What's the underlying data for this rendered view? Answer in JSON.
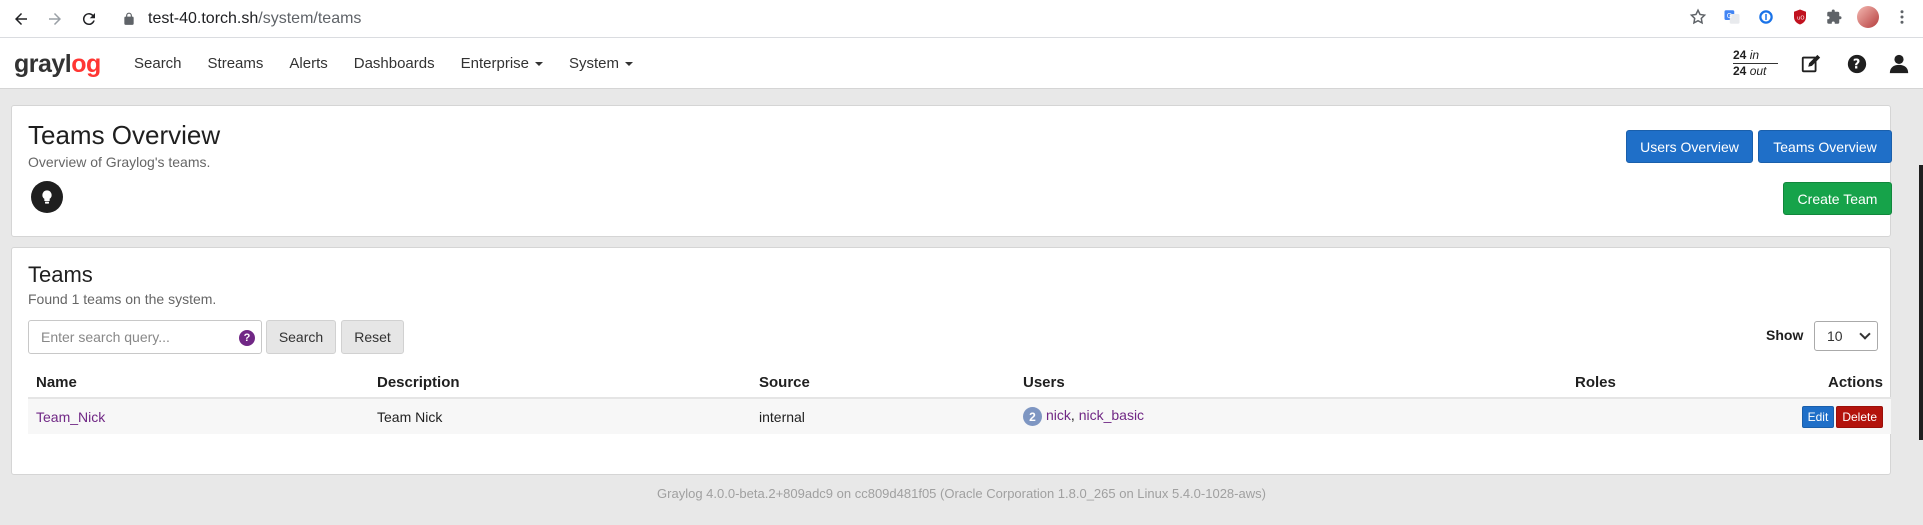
{
  "browser": {
    "url_host": "test-40.torch.sh",
    "url_path": "/system/teams"
  },
  "nav": {
    "logo_main": "grayl",
    "logo_accent": "o",
    "logo_end": "g",
    "items": [
      {
        "label": "Search"
      },
      {
        "label": "Streams"
      },
      {
        "label": "Alerts"
      },
      {
        "label": "Dashboards"
      },
      {
        "label": "Enterprise",
        "dropdown": true
      },
      {
        "label": "System",
        "dropdown": true
      }
    ],
    "throughput": {
      "in_value": "24",
      "in_label": "in",
      "out_value": "24",
      "out_label": "out"
    }
  },
  "header": {
    "title": "Teams Overview",
    "subtitle": "Overview of Graylog's teams.",
    "users_overview_label": "Users Overview",
    "teams_overview_label": "Teams Overview",
    "create_team_label": "Create Team"
  },
  "teams_section": {
    "title": "Teams",
    "subtitle": "Found 1 teams on the system.",
    "search_placeholder": "Enter search query...",
    "search_label": "Search",
    "reset_label": "Reset",
    "show_label": "Show",
    "page_size": "10",
    "columns": [
      "Name",
      "Description",
      "Source",
      "Users",
      "Roles",
      "Actions"
    ],
    "rows": [
      {
        "name": "Team_Nick",
        "description": "Team Nick",
        "source": "internal",
        "user_count": "2",
        "user_1": "nick",
        "separator": ", ",
        "user_2": "nick_basic",
        "roles": "",
        "edit_label": "Edit",
        "delete_label": "Delete"
      }
    ]
  },
  "footer": {
    "text": "Graylog 4.0.0-beta.2+809adc9 on cc809d481f05 (Oracle Corporation 1.8.0_265 on Linux 5.4.0-1028-aws)"
  },
  "colors": {
    "primary_blue": "#1f6fc8",
    "success_green": "#16a34a",
    "danger_red": "#b3130c",
    "link_purple": "#702785",
    "logo_red": "#ff3633"
  }
}
